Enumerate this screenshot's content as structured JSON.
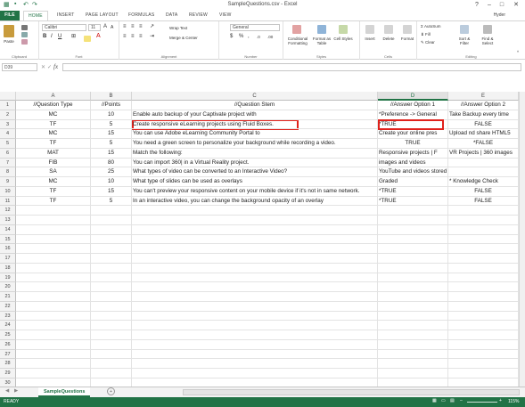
{
  "window": {
    "title": "SampleQuestions.csv - Excel",
    "user": "Hyder"
  },
  "tabs": [
    "FILE",
    "HOME",
    "INSERT",
    "PAGE LAYOUT",
    "FORMULAS",
    "DATA",
    "REVIEW",
    "VIEW"
  ],
  "ribbon": {
    "paste": "Paste",
    "font_name": "Calibri",
    "font_size": "11",
    "wrap_text": "Wrap Text",
    "merge": "Merge & Center",
    "number_format": "General",
    "cond_format": "Conditional Formatting",
    "format_table": "Format as Table",
    "cell_styles": "Cell Styles",
    "insert": "Insert",
    "delete": "Delete",
    "format": "Format",
    "autosum": "AutoSum",
    "fill": "Fill",
    "clear": "Clear",
    "sort_filter": "Sort & Filter",
    "find_select": "Find & Select",
    "groups": [
      "Clipboard",
      "Font",
      "Alignment",
      "Number",
      "Styles",
      "Cells",
      "Editing"
    ]
  },
  "formula_bar": {
    "name_box": "D39",
    "fx": "fx",
    "value": ""
  },
  "columns": [
    "A",
    "B",
    "C",
    "D",
    "E"
  ],
  "rows": [
    {
      "n": "1",
      "a": "//Question Type",
      "b": "//Points",
      "c": "//Question Stem",
      "d": "//Answer Option 1",
      "e": "//Answer Option 2"
    },
    {
      "n": "2",
      "a": "MC",
      "b": "10",
      "c": "Enable auto backup of your Captivate project with",
      "d": "*Preference -> General",
      "e": "Take Backup every time"
    },
    {
      "n": "3",
      "a": "TF",
      "b": "5",
      "c": "Create responsive eLearning projects using Fluid Boxes.",
      "d": "*TRUE",
      "e": "FALSE"
    },
    {
      "n": "4",
      "a": "MC",
      "b": "15",
      "c": "You can use Adobe eLearning Community Portal to",
      "d": "Create your online pres",
      "e": "Upload nd share HTML5"
    },
    {
      "n": "5",
      "a": "TF",
      "b": "5",
      "c": "You need a green screen to personalize your background while recording a video.",
      "d": "TRUE",
      "e": "*FALSE"
    },
    {
      "n": "6",
      "a": "MAT",
      "b": "15",
      "c": "Match the following:",
      "d": "Responsive projects | F",
      "e": "VR Projects | 360 images"
    },
    {
      "n": "7",
      "a": "FIB",
      "b": "80",
      "c": "You can import 360| in a Virtual Reality project.",
      "d": "images and videos",
      "e": ""
    },
    {
      "n": "8",
      "a": "SA",
      "b": "25",
      "c": "What types of video can be converted to an Interactive Video?",
      "d": "YouTube and videos stored in your computer",
      "e": ""
    },
    {
      "n": "9",
      "a": "MC",
      "b": "10",
      "c": "What type of slides can be used as overlays",
      "d": "Graded",
      "e": "* Knowledge Check"
    },
    {
      "n": "10",
      "a": "TF",
      "b": "15",
      "c": "You can't preview your responsive content on your mobile device if it's not in same network.",
      "d": "*TRUE",
      "e": "FALSE"
    },
    {
      "n": "11",
      "a": "TF",
      "b": "5",
      "c": "In an interactive video, you can change the background opacity of an overlay",
      "d": "*TRUE",
      "e": "FALSE"
    }
  ],
  "empty_rows": [
    "12",
    "13",
    "14",
    "15",
    "16",
    "17",
    "18",
    "19",
    "20",
    "21",
    "22",
    "23",
    "24",
    "25",
    "26",
    "27",
    "28",
    "29",
    "30",
    "31",
    "32",
    "33"
  ],
  "sheet": {
    "tab": "SampleQuestions",
    "add": "+"
  },
  "status": {
    "ready": "READY",
    "zoom": "115%"
  }
}
